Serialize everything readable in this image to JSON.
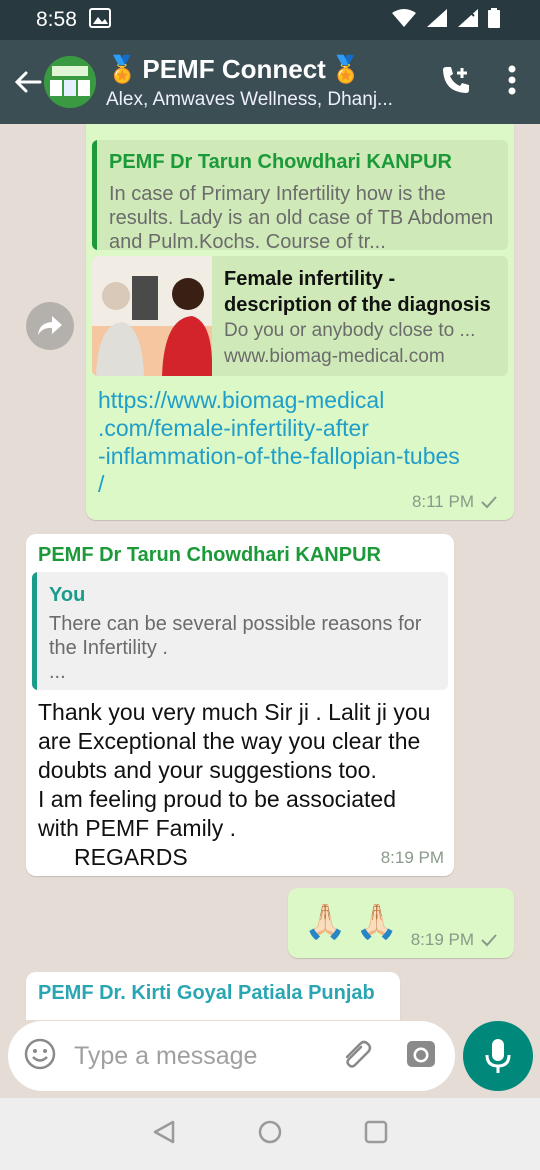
{
  "status_bar": {
    "time": "8:58"
  },
  "header": {
    "title": "PEMF Connect",
    "subtitle": "Alex, Amwaves Wellness, Dhanj..."
  },
  "messages": {
    "m1": {
      "quote_sender": "PEMF Dr Tarun Chowdhari KANPUR",
      "quote_text": "In case of Primary Infertility how is the results. Lady is an old case of TB Abdomen and Pulm.Kochs. Course of tr...",
      "link_title": "Female infertility - description of the diagnosis",
      "link_desc": "Do you or anybody close to ...",
      "link_domain": "www.biomag-medical.com",
      "body_line1": "https://www.biomag-medical",
      "body_line2": ".com/female-infertility-after",
      "body_line3": "-inflammation-of-the-fallopian-tubes",
      "body_line4": "/",
      "time": "8:11 PM"
    },
    "m2": {
      "sender": "PEMF Dr Tarun Chowdhari KANPUR",
      "quote_sender": "You",
      "quote_line1": "There can be several possible reasons for",
      "quote_line2": "the Infertility .",
      "quote_line3": "...",
      "text_line1": "Thank you very much Sir ji . Lalit ji you",
      "text_line2": "are Exceptional the way you clear the",
      "text_line3": "doubts and your suggestions too.",
      "text_line4": "I am feeling proud to be associated",
      "text_line5": "with PEMF Family .",
      "text_line6": "REGARDS",
      "time": "8:19 PM"
    },
    "m3": {
      "emoji": "🙏🏻 🙏🏻",
      "time": "8:19 PM"
    },
    "m4": {
      "sender": "PEMF Dr. Kirti Goyal Patiala Punjab"
    }
  },
  "composer": {
    "placeholder": "Type a message"
  },
  "colors": {
    "header": "#3a4e54",
    "accent": "#00897b",
    "outgoing": "#dcf8c6",
    "chat_bg": "#e5ddd5"
  }
}
